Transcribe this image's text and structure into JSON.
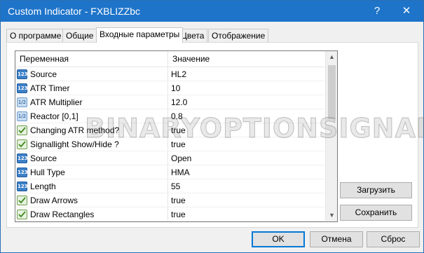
{
  "window": {
    "title": "Custom Indicator - FXBLIZZbc"
  },
  "titlebar": {
    "help_glyph": "?",
    "close_glyph": "✕"
  },
  "tabs": [
    {
      "label": "О программе",
      "active": false
    },
    {
      "label": "Общие",
      "active": false
    },
    {
      "label": "Входные параметры",
      "active": true
    },
    {
      "label": "Цвета",
      "active": false
    },
    {
      "label": "Отображение",
      "active": false
    }
  ],
  "grid": {
    "col_variable": "Переменная",
    "col_value": "Значение",
    "rows": [
      {
        "type": "int",
        "icon_text": "123",
        "name": "Source",
        "value": "HL2"
      },
      {
        "type": "int",
        "icon_text": "123",
        "name": "ATR Timer",
        "value": "10"
      },
      {
        "type": "double",
        "icon_text": "1/2",
        "name": "ATR Multiplier",
        "value": "12.0"
      },
      {
        "type": "double",
        "icon_text": "1/2",
        "name": "Reactor [0,1]",
        "value": "0.8"
      },
      {
        "type": "bool",
        "icon_text": "",
        "name": "Changing ATR method?",
        "value": "true"
      },
      {
        "type": "bool",
        "icon_text": "",
        "name": "Signallight Show/Hide ?",
        "value": "true"
      },
      {
        "type": "int",
        "icon_text": "123",
        "name": "Source",
        "value": "Open"
      },
      {
        "type": "int",
        "icon_text": "123",
        "name": "Hull Type",
        "value": "HMA"
      },
      {
        "type": "int",
        "icon_text": "123",
        "name": "Length",
        "value": "55"
      },
      {
        "type": "bool",
        "icon_text": "",
        "name": "Draw Arrows",
        "value": "true"
      },
      {
        "type": "bool",
        "icon_text": "",
        "name": "Draw Rectangles",
        "value": "true"
      }
    ]
  },
  "buttons": {
    "load": "Загрузить",
    "save": "Сохранить",
    "ok": "OK",
    "cancel": "Отмена",
    "reset": "Сброс"
  },
  "watermark": "BINARYOPTIONSIGNALS.COM"
}
